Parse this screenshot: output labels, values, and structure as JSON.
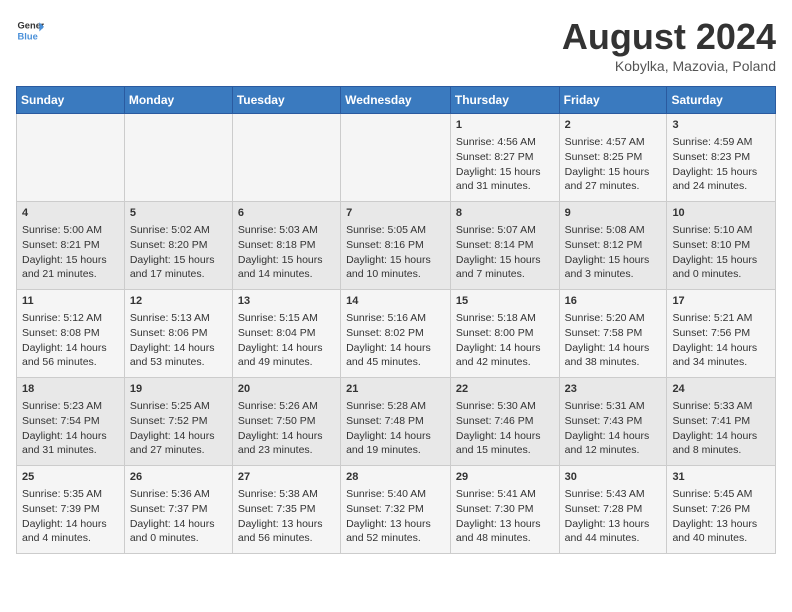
{
  "logo": {
    "line1": "General",
    "line2": "Blue"
  },
  "title": "August 2024",
  "subtitle": "Kobylka, Mazovia, Poland",
  "headers": [
    "Sunday",
    "Monday",
    "Tuesday",
    "Wednesday",
    "Thursday",
    "Friday",
    "Saturday"
  ],
  "weeks": [
    [
      {
        "day": "",
        "content": ""
      },
      {
        "day": "",
        "content": ""
      },
      {
        "day": "",
        "content": ""
      },
      {
        "day": "",
        "content": ""
      },
      {
        "day": "1",
        "content": "Sunrise: 4:56 AM\nSunset: 8:27 PM\nDaylight: 15 hours\nand 31 minutes."
      },
      {
        "day": "2",
        "content": "Sunrise: 4:57 AM\nSunset: 8:25 PM\nDaylight: 15 hours\nand 27 minutes."
      },
      {
        "day": "3",
        "content": "Sunrise: 4:59 AM\nSunset: 8:23 PM\nDaylight: 15 hours\nand 24 minutes."
      }
    ],
    [
      {
        "day": "4",
        "content": "Sunrise: 5:00 AM\nSunset: 8:21 PM\nDaylight: 15 hours\nand 21 minutes."
      },
      {
        "day": "5",
        "content": "Sunrise: 5:02 AM\nSunset: 8:20 PM\nDaylight: 15 hours\nand 17 minutes."
      },
      {
        "day": "6",
        "content": "Sunrise: 5:03 AM\nSunset: 8:18 PM\nDaylight: 15 hours\nand 14 minutes."
      },
      {
        "day": "7",
        "content": "Sunrise: 5:05 AM\nSunset: 8:16 PM\nDaylight: 15 hours\nand 10 minutes."
      },
      {
        "day": "8",
        "content": "Sunrise: 5:07 AM\nSunset: 8:14 PM\nDaylight: 15 hours\nand 7 minutes."
      },
      {
        "day": "9",
        "content": "Sunrise: 5:08 AM\nSunset: 8:12 PM\nDaylight: 15 hours\nand 3 minutes."
      },
      {
        "day": "10",
        "content": "Sunrise: 5:10 AM\nSunset: 8:10 PM\nDaylight: 15 hours\nand 0 minutes."
      }
    ],
    [
      {
        "day": "11",
        "content": "Sunrise: 5:12 AM\nSunset: 8:08 PM\nDaylight: 14 hours\nand 56 minutes."
      },
      {
        "day": "12",
        "content": "Sunrise: 5:13 AM\nSunset: 8:06 PM\nDaylight: 14 hours\nand 53 minutes."
      },
      {
        "day": "13",
        "content": "Sunrise: 5:15 AM\nSunset: 8:04 PM\nDaylight: 14 hours\nand 49 minutes."
      },
      {
        "day": "14",
        "content": "Sunrise: 5:16 AM\nSunset: 8:02 PM\nDaylight: 14 hours\nand 45 minutes."
      },
      {
        "day": "15",
        "content": "Sunrise: 5:18 AM\nSunset: 8:00 PM\nDaylight: 14 hours\nand 42 minutes."
      },
      {
        "day": "16",
        "content": "Sunrise: 5:20 AM\nSunset: 7:58 PM\nDaylight: 14 hours\nand 38 minutes."
      },
      {
        "day": "17",
        "content": "Sunrise: 5:21 AM\nSunset: 7:56 PM\nDaylight: 14 hours\nand 34 minutes."
      }
    ],
    [
      {
        "day": "18",
        "content": "Sunrise: 5:23 AM\nSunset: 7:54 PM\nDaylight: 14 hours\nand 31 minutes."
      },
      {
        "day": "19",
        "content": "Sunrise: 5:25 AM\nSunset: 7:52 PM\nDaylight: 14 hours\nand 27 minutes."
      },
      {
        "day": "20",
        "content": "Sunrise: 5:26 AM\nSunset: 7:50 PM\nDaylight: 14 hours\nand 23 minutes."
      },
      {
        "day": "21",
        "content": "Sunrise: 5:28 AM\nSunset: 7:48 PM\nDaylight: 14 hours\nand 19 minutes."
      },
      {
        "day": "22",
        "content": "Sunrise: 5:30 AM\nSunset: 7:46 PM\nDaylight: 14 hours\nand 15 minutes."
      },
      {
        "day": "23",
        "content": "Sunrise: 5:31 AM\nSunset: 7:43 PM\nDaylight: 14 hours\nand 12 minutes."
      },
      {
        "day": "24",
        "content": "Sunrise: 5:33 AM\nSunset: 7:41 PM\nDaylight: 14 hours\nand 8 minutes."
      }
    ],
    [
      {
        "day": "25",
        "content": "Sunrise: 5:35 AM\nSunset: 7:39 PM\nDaylight: 14 hours\nand 4 minutes."
      },
      {
        "day": "26",
        "content": "Sunrise: 5:36 AM\nSunset: 7:37 PM\nDaylight: 14 hours\nand 0 minutes."
      },
      {
        "day": "27",
        "content": "Sunrise: 5:38 AM\nSunset: 7:35 PM\nDaylight: 13 hours\nand 56 minutes."
      },
      {
        "day": "28",
        "content": "Sunrise: 5:40 AM\nSunset: 7:32 PM\nDaylight: 13 hours\nand 52 minutes."
      },
      {
        "day": "29",
        "content": "Sunrise: 5:41 AM\nSunset: 7:30 PM\nDaylight: 13 hours\nand 48 minutes."
      },
      {
        "day": "30",
        "content": "Sunrise: 5:43 AM\nSunset: 7:28 PM\nDaylight: 13 hours\nand 44 minutes."
      },
      {
        "day": "31",
        "content": "Sunrise: 5:45 AM\nSunset: 7:26 PM\nDaylight: 13 hours\nand 40 minutes."
      }
    ]
  ]
}
